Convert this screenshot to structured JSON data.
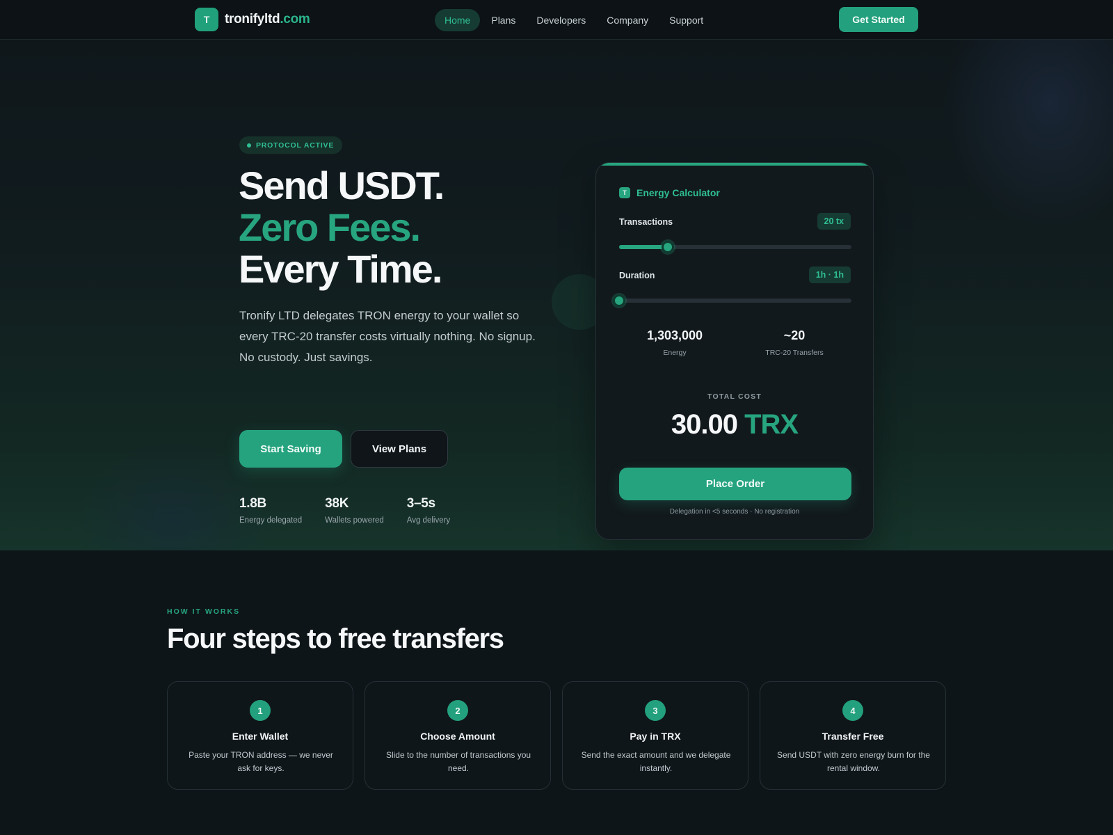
{
  "nav": {
    "logo_mark": "T",
    "logo_name": "tronifyltd",
    "logo_tld": ".com",
    "links": [
      "Home",
      "Plans",
      "Developers",
      "Company",
      "Support"
    ],
    "cta": "Get Started"
  },
  "hero": {
    "badge": "PROTOCOL ACTIVE",
    "headline_line1": "Send USDT.",
    "headline_line2": "Zero Fees.",
    "headline_line3": "Every Time.",
    "lede": "Tronify LTD delegates TRON energy to your wallet so every TRC-20 transfer costs virtually nothing. No signup. No custody. Just savings.",
    "primary_button": "Start Saving",
    "secondary_button": "View Plans",
    "stats": [
      {
        "value": "1.8B",
        "label": "Energy delegated"
      },
      {
        "value": "38K",
        "label": "Wallets powered"
      },
      {
        "value": "3–5s",
        "label": "Avg delivery"
      }
    ]
  },
  "calculator": {
    "icon_letter": "T",
    "title": "Energy Calculator",
    "transactions_label": "Transactions",
    "transactions_value": "20 tx",
    "transactions_fraction": 0.21,
    "duration_label": "Duration",
    "duration_value": "1h · 1h",
    "duration_fraction": 0.0,
    "energy_value": "1,303,000",
    "energy_label": "Energy",
    "transfers_value": "~20",
    "transfers_label": "TRC-20 Transfers",
    "total_label": "TOTAL COST",
    "total_amount": "30.00",
    "total_unit": "TRX",
    "order_button": "Place Order",
    "order_note": "Delegation in <5 seconds · No registration"
  },
  "how_it_works": {
    "kicker": "HOW IT WORKS",
    "title": "Four steps to free transfers",
    "steps": [
      {
        "num": "1",
        "title": "Enter Wallet",
        "desc": "Paste your TRON address — we never ask for keys."
      },
      {
        "num": "2",
        "title": "Choose Amount",
        "desc": "Slide to the number of transactions you need."
      },
      {
        "num": "3",
        "title": "Pay in TRX",
        "desc": "Send the exact amount and we delegate instantly."
      },
      {
        "num": "4",
        "title": "Transfer Free",
        "desc": "Send USDT with zero energy burn for the rental window."
      }
    ]
  },
  "colors": {
    "accent": "#27a57f",
    "background": "#0e1519"
  }
}
